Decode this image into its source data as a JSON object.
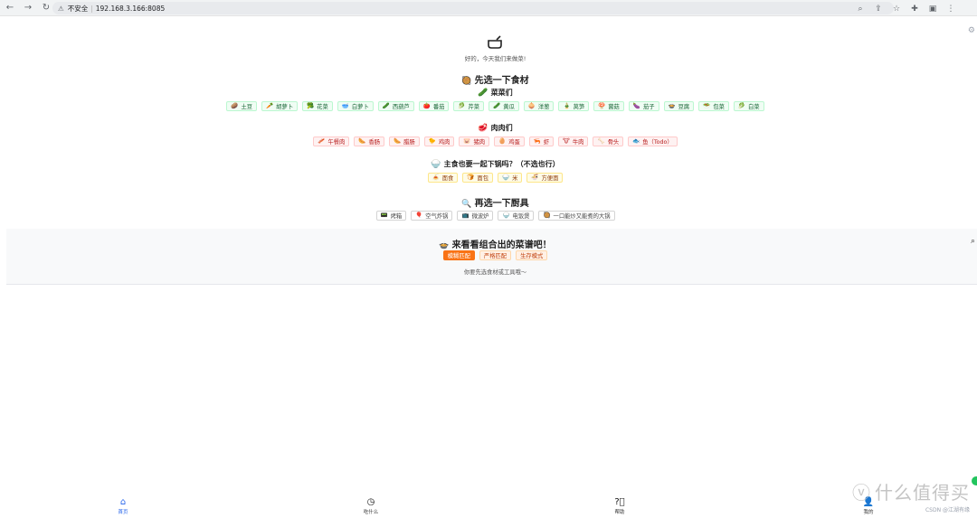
{
  "browser": {
    "insecure_label": "不安全",
    "url": "192.168.3.166:8085"
  },
  "header": {
    "subtitle": "好的，今天我们来做菜!"
  },
  "ingredients": {
    "title": "先选一下食材",
    "vegetables": {
      "title": "菜菜们",
      "items": [
        {
          "icon": "🥔",
          "label": "土豆"
        },
        {
          "icon": "🥕",
          "label": "胡萝卜"
        },
        {
          "icon": "🥦",
          "label": "花菜"
        },
        {
          "icon": "🥣",
          "label": "白萝卜"
        },
        {
          "icon": "🥒",
          "label": "西葫芦"
        },
        {
          "icon": "🍅",
          "label": "番茄"
        },
        {
          "icon": "🥬",
          "label": "芹菜"
        },
        {
          "icon": "🥒",
          "label": "黄瓜"
        },
        {
          "icon": "🧅",
          "label": "洋葱"
        },
        {
          "icon": "🎍",
          "label": "莴笋"
        },
        {
          "icon": "🍄",
          "label": "菌菇"
        },
        {
          "icon": "🍆",
          "label": "茄子"
        },
        {
          "icon": "🍲",
          "label": "豆腐"
        },
        {
          "icon": "🥗",
          "label": "包菜"
        },
        {
          "icon": "🥬",
          "label": "白菜"
        }
      ]
    },
    "meats": {
      "title": "肉肉们",
      "items": [
        {
          "icon": "🥓",
          "label": "午餐肉"
        },
        {
          "icon": "🌭",
          "label": "香肠"
        },
        {
          "icon": "🌭",
          "label": "腊肠"
        },
        {
          "icon": "🐤",
          "label": "鸡肉"
        },
        {
          "icon": "🐷",
          "label": "猪肉"
        },
        {
          "icon": "🥚",
          "label": "鸡蛋"
        },
        {
          "icon": "🦐",
          "label": "虾"
        },
        {
          "icon": "🐮",
          "label": "牛肉"
        },
        {
          "icon": "🦴",
          "label": "骨头"
        },
        {
          "icon": "🐟",
          "label": "鱼（Todo）"
        }
      ]
    },
    "staples": {
      "title": "主食也要一起下锅吗？（不选也行）",
      "items": [
        {
          "icon": "🍝",
          "label": "面食"
        },
        {
          "icon": "🍞",
          "label": "面包"
        },
        {
          "icon": "🍚",
          "label": "米"
        },
        {
          "icon": "🍜",
          "label": "方便面"
        }
      ]
    }
  },
  "tools": {
    "title": "再选一下厨具",
    "items": [
      {
        "icon": "📟",
        "label": "烤箱"
      },
      {
        "icon": "🎈",
        "label": "空气炸锅"
      },
      {
        "icon": "📺",
        "label": "微波炉"
      },
      {
        "icon": "🍚",
        "label": "电饭煲"
      },
      {
        "icon": "🥘",
        "label": "一口能炒又能煮的大锅"
      }
    ]
  },
  "result": {
    "title": "来看看组合出的菜谱吧！",
    "modes": [
      {
        "label": "模糊匹配",
        "active": true
      },
      {
        "label": "严格匹配",
        "active": false
      },
      {
        "label": "生存模式",
        "active": false
      }
    ],
    "hint": "你要先选食材或工具哦～"
  },
  "bottom_nav": [
    {
      "label": "首页",
      "icon": "home-icon",
      "active": true
    },
    {
      "label": "吃什么",
      "icon": "compass-icon",
      "active": false
    },
    {
      "label": "帮助",
      "icon": "help-icon",
      "active": false
    },
    {
      "label": "我的",
      "icon": "user-icon",
      "active": false
    }
  ],
  "watermark": {
    "brand": "什么值得买",
    "credit": "CSDN @江湖有缘"
  },
  "colors": {
    "accent": "#f97316",
    "active_tab": "#2563eb",
    "veg": "#166534",
    "meat": "#b91c1c",
    "staple": "#92400e"
  }
}
